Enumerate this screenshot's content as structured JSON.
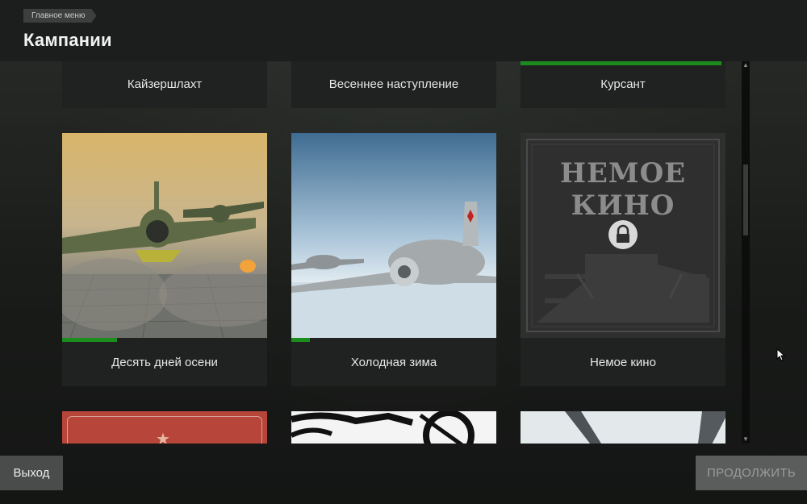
{
  "header": {
    "breadcrumb": "Главное меню",
    "title": "Кампании"
  },
  "campaigns_row1": [
    {
      "label": "Кайзершлахт"
    },
    {
      "label": "Весеннее наступление"
    },
    {
      "label": "Курсант",
      "selected": true
    }
  ],
  "campaigns_row2": [
    {
      "label": "Десять дней осени",
      "progress": 0.27
    },
    {
      "label": "Холодная зима",
      "progress": 0.09
    },
    {
      "label": "Немое кино",
      "locked": true,
      "poster_title": "НЕМОЕ КИНО"
    }
  ],
  "footer": {
    "exit_label": "Выход",
    "continue_label": "ПРОДОЛЖИТЬ"
  },
  "colors": {
    "accent": "#1d8a1d",
    "header_bg": "#1c1d1d",
    "card_bg": "#202121"
  },
  "icons": [
    "lock-icon",
    "star-icon",
    "scroll-up-icon",
    "scroll-down-icon",
    "cursor-icon"
  ]
}
